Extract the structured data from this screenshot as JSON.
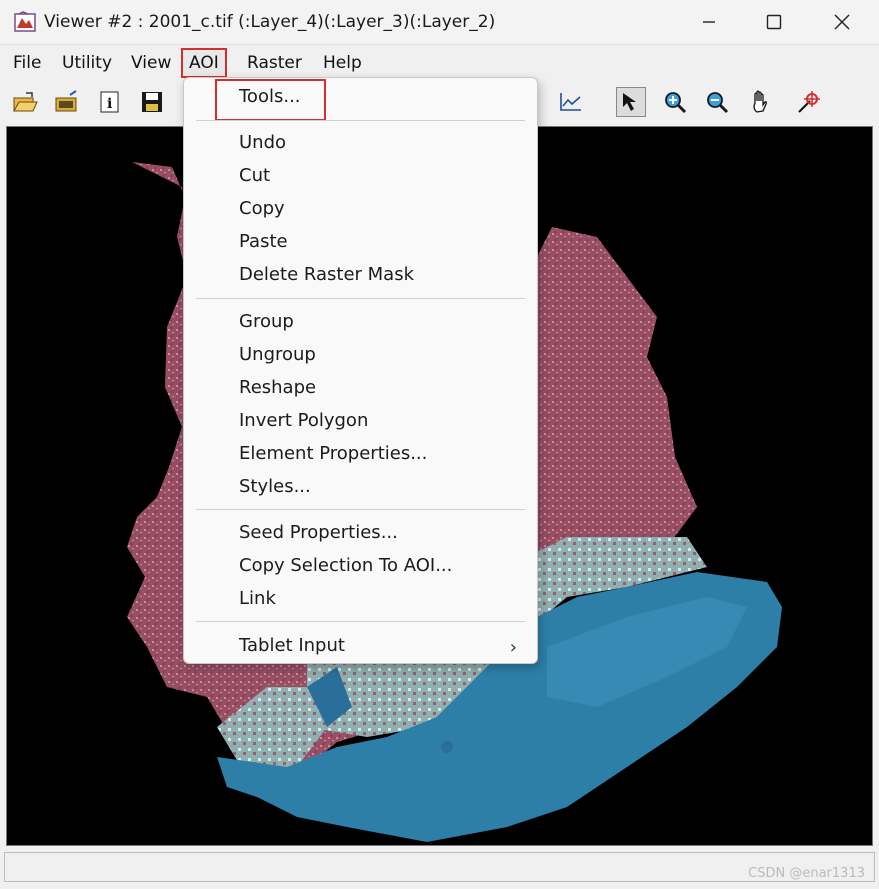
{
  "window": {
    "title": "Viewer #2 : 2001_c.tif (:Layer_4)(:Layer_3)(:Layer_2)",
    "minimize_glyph": "—",
    "maximize_glyph": "☐",
    "close_glyph": "✕"
  },
  "menubar": {
    "items": [
      {
        "label": "File"
      },
      {
        "label": "Utility"
      },
      {
        "label": "View"
      },
      {
        "label": "AOI"
      },
      {
        "label": "Raster"
      },
      {
        "label": "Help"
      }
    ]
  },
  "toolbar": {
    "icons": [
      "open-folder-icon",
      "open-layer-icon",
      "info-icon",
      "save-icon",
      "profile-chart-icon",
      "select-arrow-icon",
      "zoom-in-icon",
      "zoom-out-icon",
      "pan-hand-icon",
      "inquire-cursor-icon"
    ]
  },
  "aoi_menu": {
    "groups": [
      [
        {
          "label": "Tools..."
        }
      ],
      [
        {
          "label": "Undo"
        },
        {
          "label": "Cut"
        },
        {
          "label": "Copy"
        },
        {
          "label": "Paste"
        },
        {
          "label": "Delete Raster Mask"
        }
      ],
      [
        {
          "label": "Group"
        },
        {
          "label": "Ungroup"
        },
        {
          "label": "Reshape"
        },
        {
          "label": "Invert Polygon"
        },
        {
          "label": "Element Properties..."
        },
        {
          "label": "Styles..."
        }
      ],
      [
        {
          "label": "Seed Properties..."
        },
        {
          "label": "Copy Selection To AOI..."
        },
        {
          "label": "Link"
        }
      ],
      [
        {
          "label": "Tablet Input",
          "submenu_arrow": "›"
        }
      ]
    ]
  },
  "watermark": "CSDN @enar1313",
  "colors": {
    "highlight": "#d32f2f",
    "land": "#9a4d63",
    "water": "#2e7fa8",
    "background": "#000000"
  }
}
